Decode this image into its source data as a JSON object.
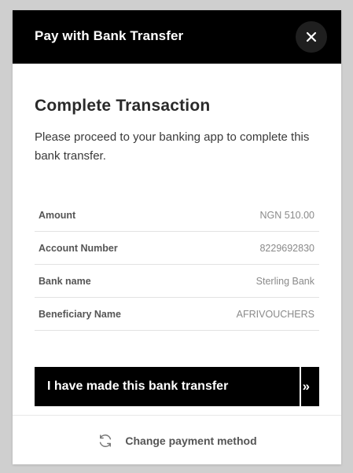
{
  "header": {
    "title": "Pay with Bank Transfer",
    "close_icon": "close-icon"
  },
  "main": {
    "title": "Complete Transaction",
    "description": "Please proceed to your banking app to complete this bank transfer."
  },
  "details": [
    {
      "label": "Amount",
      "value": "NGN 510.00"
    },
    {
      "label": "Account Number",
      "value": "8229692830"
    },
    {
      "label": "Bank name",
      "value": "Sterling Bank"
    },
    {
      "label": "Beneficiary Name",
      "value": "AFRIVOUCHERS"
    }
  ],
  "confirm_button": {
    "label": "I have made this bank transfer",
    "icon": "double-chevron-right-icon"
  },
  "footer": {
    "label": "Change payment method",
    "icon": "refresh-icon"
  },
  "colors": {
    "header_bg": "#000000",
    "button_bg": "#000000",
    "page_bg": "#cfcfcf"
  }
}
